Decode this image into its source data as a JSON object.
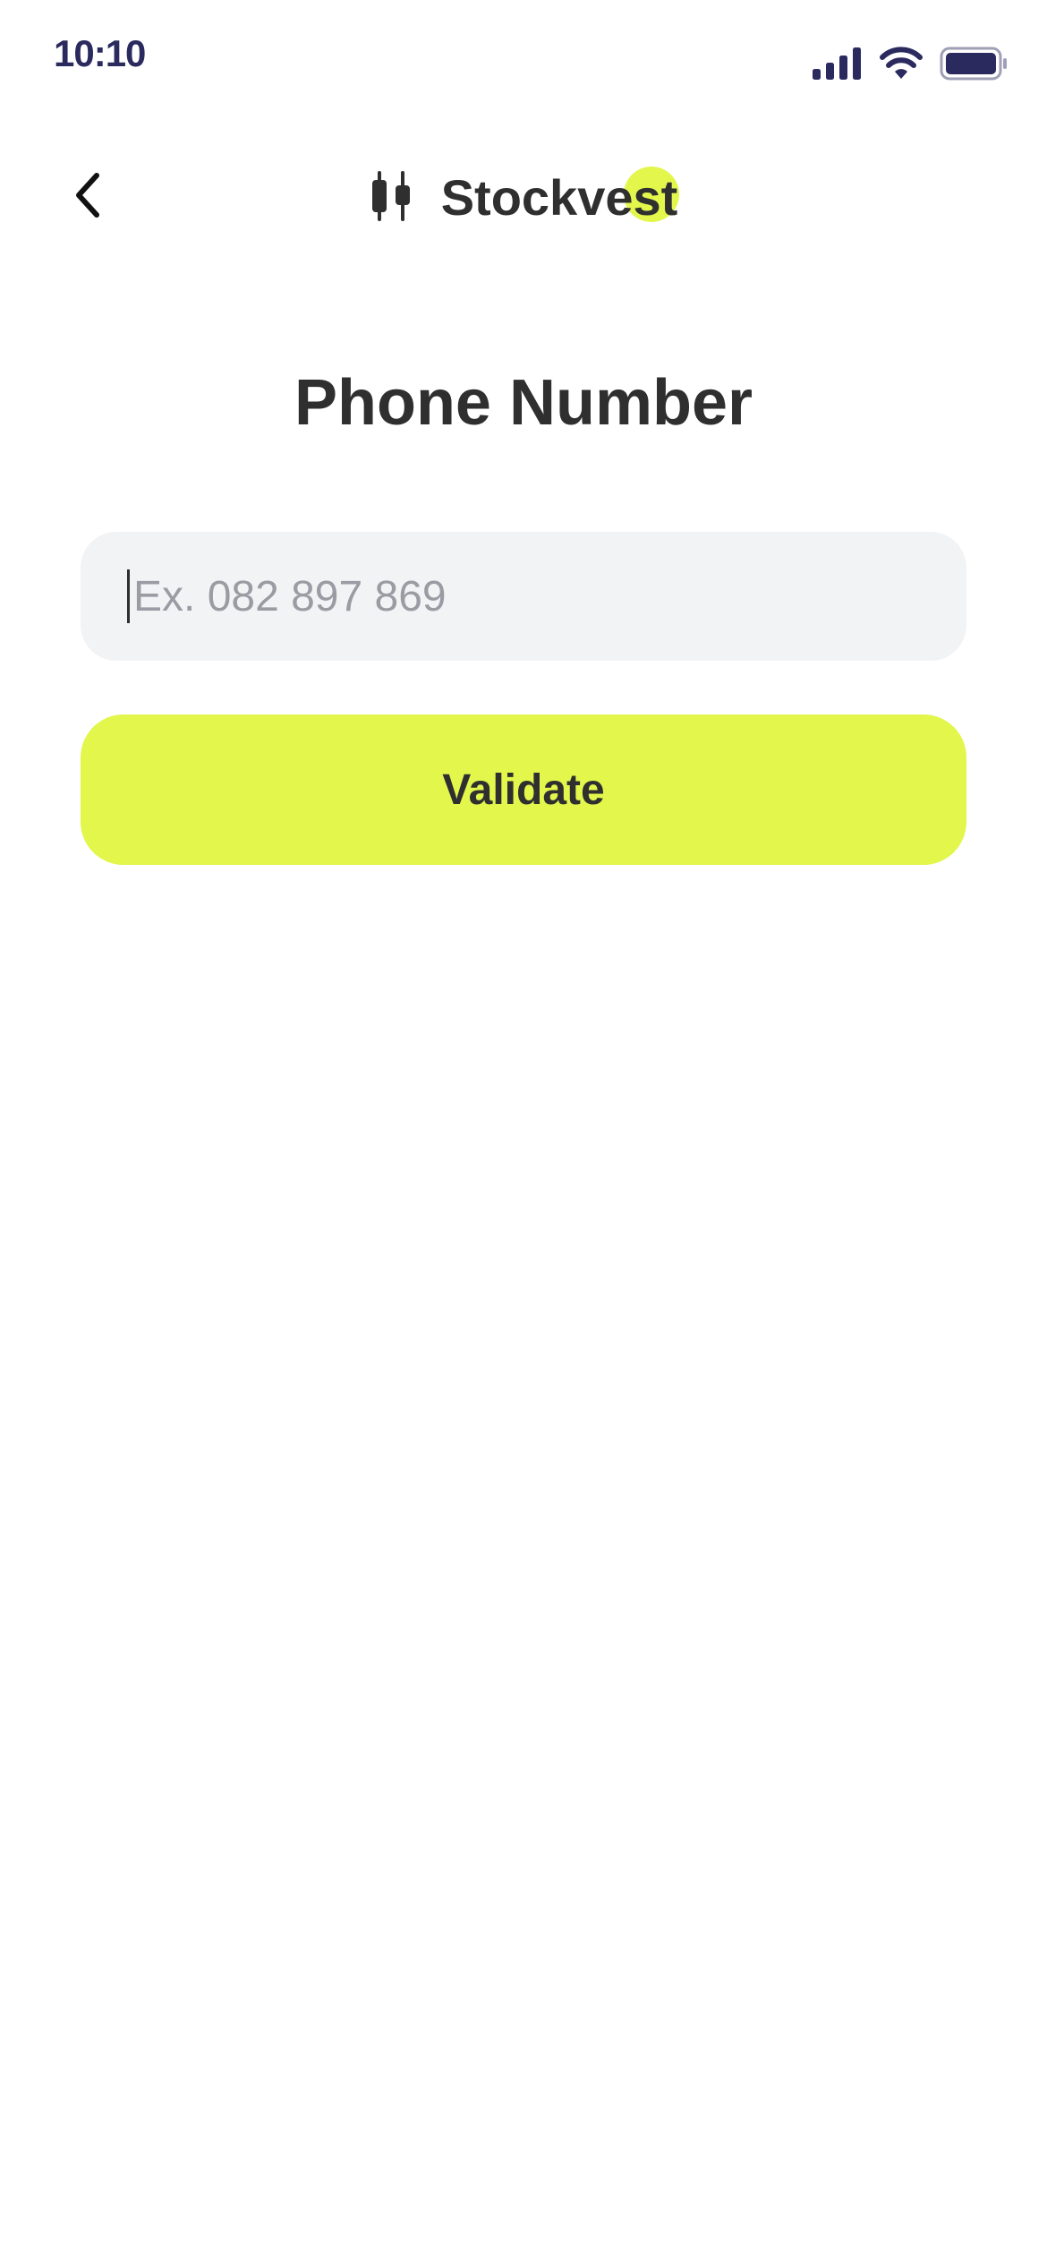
{
  "status_bar": {
    "time": "10:10",
    "icons": [
      "cellular-signal-icon",
      "wifi-icon",
      "battery-icon"
    ]
  },
  "header": {
    "back_icon": "chevron-left-icon",
    "logo_icon": "candlestick-icon",
    "brand_name": "Stockvest"
  },
  "main": {
    "title": "Phone Number",
    "phone_input": {
      "value": "",
      "placeholder": "Ex. 082 897 869"
    },
    "validate_label": "Validate"
  },
  "colors": {
    "accent": "#E2F64C",
    "text": "#2F2F2F",
    "input_bg": "#F2F3F5",
    "status_bar": "#2B2A5E"
  }
}
